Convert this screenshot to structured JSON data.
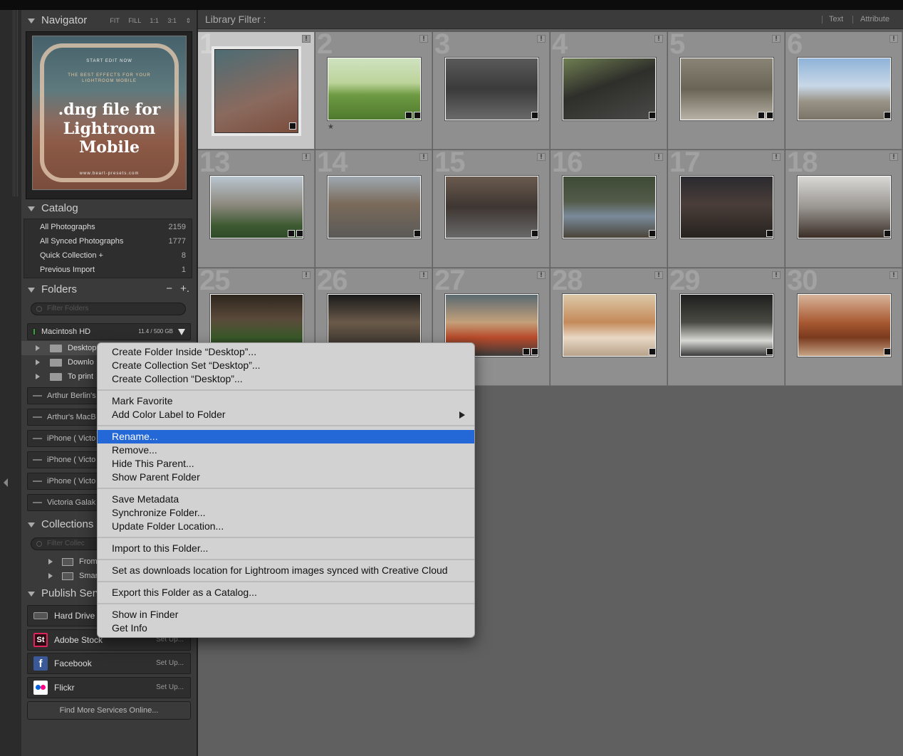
{
  "navigator": {
    "title": "Navigator",
    "zoom_options": [
      "FIT",
      "FILL",
      "1:1",
      "3:1"
    ],
    "cover": {
      "line1": "START EDIT NOW",
      "line2": "THE BEST EFFECTS FOR YOUR",
      "line3": "LIGHTROOM MOBILE",
      "title_1": ".dng file for",
      "title_2": "Lightroom",
      "title_3": "Mobile",
      "footer": "www.beart-presets.com"
    }
  },
  "catalog": {
    "title": "Catalog",
    "items": [
      {
        "label": "All Photographs",
        "count": "2159"
      },
      {
        "label": "All Synced Photographs",
        "count": "1777"
      },
      {
        "label": "Quick Collection  +",
        "count": "8"
      },
      {
        "label": "Previous Import",
        "count": "1"
      }
    ]
  },
  "folders": {
    "title": "Folders",
    "minus": "−",
    "plus": "+.",
    "filter_placeholder": "Filter Folders",
    "volume": {
      "name": "Macintosh HD",
      "capacity": "11.4 / 500 GB"
    },
    "items": [
      {
        "label": "Desktop"
      },
      {
        "label": "Downlo"
      },
      {
        "label": "To print"
      }
    ],
    "devices": [
      {
        "label": "Arthur Berlin's"
      },
      {
        "label": "Arthur's MacB"
      },
      {
        "label": "iPhone ( Victo"
      },
      {
        "label": "iPhone ( Victo"
      },
      {
        "label": "iPhone ( Victo"
      },
      {
        "label": "Victoria Galak"
      }
    ]
  },
  "collections": {
    "title": "Collections",
    "filter_placeholder": "Filter Collec",
    "items": [
      {
        "label": "From"
      },
      {
        "label": "Smar"
      }
    ]
  },
  "publish": {
    "title": "Publish Serv",
    "services": [
      {
        "label": "Hard Drive",
        "setup": "",
        "icon": "hard-drive-icon"
      },
      {
        "label": "Adobe Stock",
        "setup": "Set Up...",
        "icon": "adobe-stock-icon",
        "icon_text": "St",
        "color": "#e0245e"
      },
      {
        "label": "Facebook",
        "setup": "Set Up...",
        "icon": "facebook-icon",
        "icon_text": "f",
        "color": "#3b5998"
      },
      {
        "label": "Flickr",
        "setup": "Set Up...",
        "icon": "flickr-icon",
        "color": "#ffffff"
      }
    ],
    "find_more": "Find More Services Online..."
  },
  "library_filter": {
    "title": "Library Filter :",
    "options": [
      "Text",
      "Attribute"
    ]
  },
  "grid": {
    "cells": [
      {
        "num": "1",
        "selected": true
      },
      {
        "num": "2",
        "star": "★"
      },
      {
        "num": "3"
      },
      {
        "num": "4"
      },
      {
        "num": "5"
      },
      {
        "num": "6"
      },
      {
        "num": "13"
      },
      {
        "num": "14"
      },
      {
        "num": "15"
      },
      {
        "num": "16"
      },
      {
        "num": "17"
      },
      {
        "num": "18"
      },
      {
        "num": "25"
      },
      {
        "num": "26"
      },
      {
        "num": "27"
      },
      {
        "num": "28"
      },
      {
        "num": "29"
      },
      {
        "num": "30"
      }
    ],
    "flag_glyph": "!"
  },
  "context_menu": {
    "groups": [
      [
        "Create Folder Inside “Desktop”...",
        "Create Collection Set “Desktop”...",
        "Create Collection “Desktop”..."
      ],
      [
        "Mark Favorite",
        "Add Color Label to Folder"
      ],
      [
        "Rename...",
        "Remove...",
        "Hide This Parent...",
        "Show Parent Folder"
      ],
      [
        "Save Metadata",
        "Synchronize Folder...",
        "Update Folder Location..."
      ],
      [
        "Import to this Folder..."
      ],
      [
        "Set as downloads location for Lightroom images synced with Creative Cloud"
      ],
      [
        "Export this Folder as a Catalog..."
      ],
      [
        "Show in Finder",
        "Get Info"
      ]
    ],
    "highlighted": "Rename...",
    "highlight_color": "#2468d8"
  }
}
